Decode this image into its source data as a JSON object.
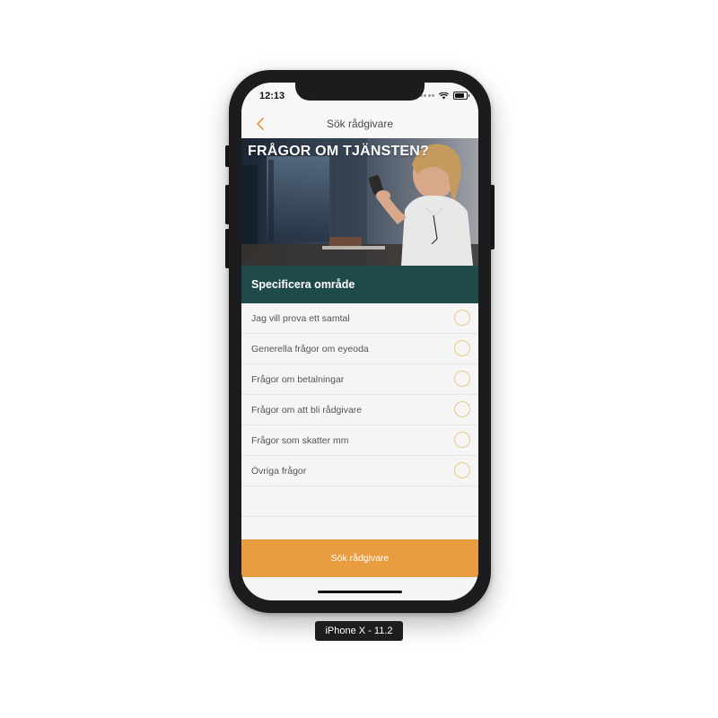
{
  "status_bar": {
    "time": "12:13"
  },
  "nav": {
    "title": "Sök rådgivare",
    "back_icon": "chevron-left-icon"
  },
  "hero": {
    "title": "FRÅGOR OM TJÄNSTEN?"
  },
  "section": {
    "title": "Specificera område"
  },
  "options": [
    {
      "label": "Jag vill prova ett samtal",
      "selected": false
    },
    {
      "label": "Generella frågor om eyeoda",
      "selected": false
    },
    {
      "label": "Frågor om betalningar",
      "selected": false
    },
    {
      "label": "Frågor om att bli rådgivare",
      "selected": false
    },
    {
      "label": "Frågor som skatter mm",
      "selected": false
    },
    {
      "label": "Övriga frågor",
      "selected": false
    }
  ],
  "cta": {
    "label": "Sök rådgivare"
  },
  "device_caption": "iPhone X - 11.2",
  "colors": {
    "accent": "#ea9d40",
    "header_teal": "#1f4a4a",
    "radio_border": "#e9c88a",
    "list_background": "#f5f5f5"
  }
}
